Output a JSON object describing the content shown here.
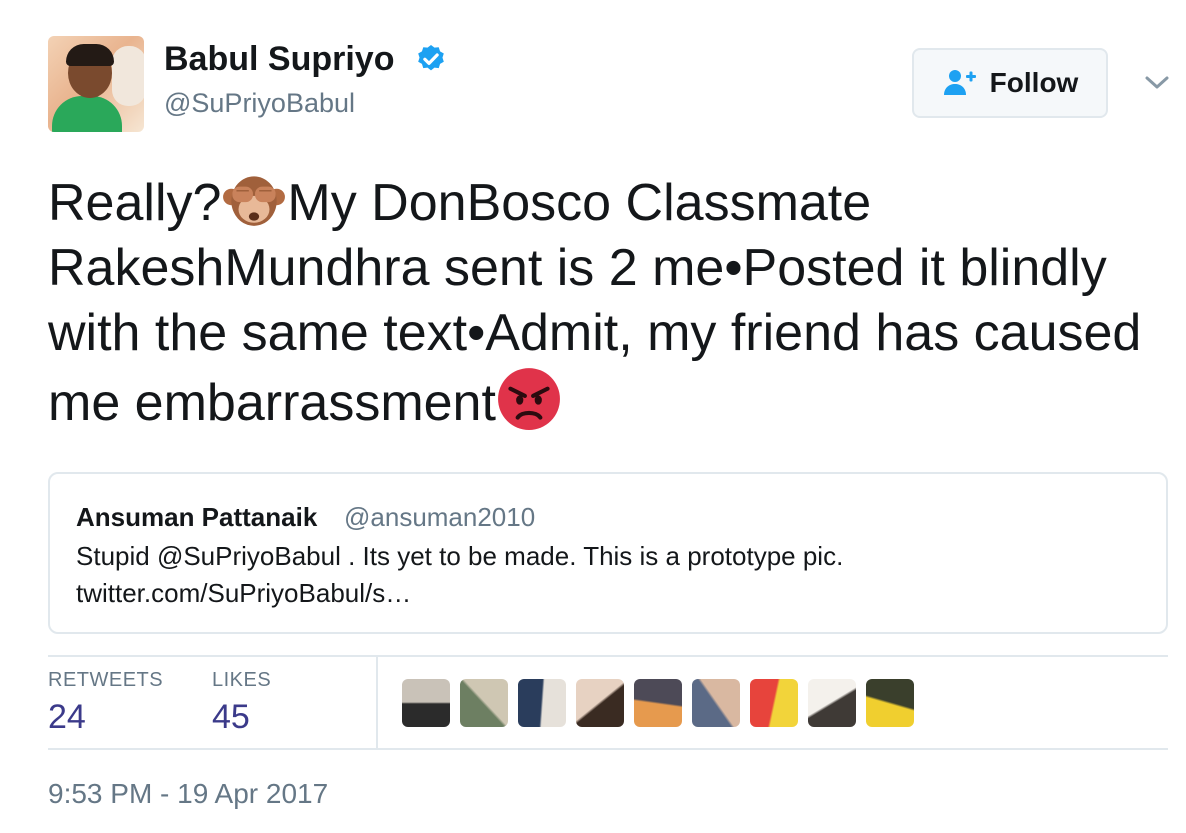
{
  "author": {
    "name": "Babul Supriyo",
    "handle": "@SuPriyoBabul",
    "verified": true,
    "avatar_icon": "profile-photo"
  },
  "follow_button": {
    "label": "Follow",
    "icon": "add-person-icon",
    "accent_color": "#1da1f2"
  },
  "menu_icon": "chevron-down-icon",
  "tweet": {
    "part1": "Really?",
    "part2": "My DonBosco Classmate RakeshMundhra sent is 2 me•Posted it blindly with the same text•Admit, my friend has caused me embarrassment",
    "emoji1": "see-no-evil-monkey",
    "emoji2": "angry-face"
  },
  "quoted_tweet": {
    "name": "Ansuman Pattanaik",
    "handle": "@ansuman2010",
    "text": "Stupid @SuPriyoBabul . Its yet to be made. This is a prototype pic.",
    "link": "twitter.com/SuPriyoBabul/s…"
  },
  "stats": {
    "retweets_label": "RETWEETS",
    "retweets_value": "24",
    "likes_label": "LIKES",
    "likes_value": "45"
  },
  "likers": [
    {
      "name": "liker-avatar-1",
      "c1": "#2b2b2b",
      "c2": "#c9c2b8"
    },
    {
      "name": "liker-avatar-2",
      "c1": "#6d7f62",
      "c2": "#cfc7b3"
    },
    {
      "name": "liker-avatar-3",
      "c1": "#2a3d5c",
      "c2": "#e6e1da"
    },
    {
      "name": "liker-avatar-4",
      "c1": "#e7d2c2",
      "c2": "#3a2b22"
    },
    {
      "name": "liker-avatar-5",
      "c1": "#e69a4e",
      "c2": "#4d4a57"
    },
    {
      "name": "liker-avatar-6",
      "c1": "#5b6a86",
      "c2": "#d9b8a1"
    },
    {
      "name": "liker-avatar-7",
      "c1": "#e7443c",
      "c2": "#f2d43a"
    },
    {
      "name": "liker-avatar-8",
      "c1": "#f4f1ec",
      "c2": "#3f3a36"
    },
    {
      "name": "liker-avatar-9",
      "c1": "#f0cf2f",
      "c2": "#3a3f2c"
    }
  ],
  "timestamp": "9:53 PM - 19 Apr 2017",
  "colors": {
    "text": "#14171a",
    "secondary": "#657786",
    "stat_value": "#3b3a8a",
    "border": "#e1e8ed",
    "verified": "#1da1f2"
  }
}
